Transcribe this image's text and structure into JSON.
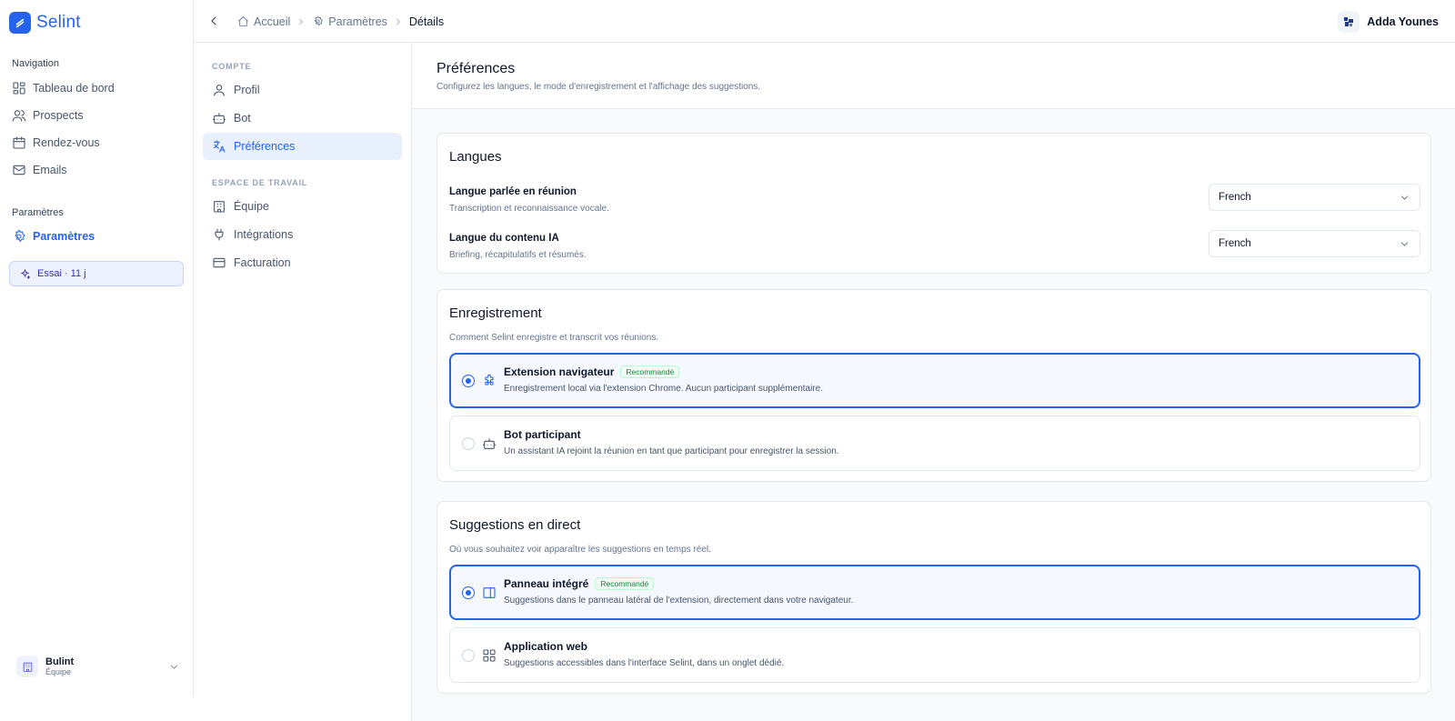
{
  "app": {
    "name": "Selint"
  },
  "sidebar": {
    "nav_section": "Navigation",
    "items": [
      {
        "label": "Tableau de bord",
        "icon": "dashboard-icon"
      },
      {
        "label": "Prospects",
        "icon": "users-icon"
      },
      {
        "label": "Rendez-vous",
        "icon": "calendar-icon"
      },
      {
        "label": "Emails",
        "icon": "mail-icon"
      }
    ],
    "settings_section": "Paramètres",
    "settings_item": {
      "label": "Paramètres",
      "icon": "gear-icon"
    },
    "trial": "Essai · 11 j",
    "team": {
      "name": "Bulint",
      "role": "Équipe"
    }
  },
  "header": {
    "breadcrumbs": [
      "Accueil",
      "Paramètres",
      "Détails"
    ],
    "user": "Adda Younes"
  },
  "settings_nav": {
    "account_section": "COMPTE",
    "account_items": [
      {
        "label": "Profil",
        "icon": "user-icon"
      },
      {
        "label": "Bot",
        "icon": "bot-icon"
      },
      {
        "label": "Préférences",
        "icon": "translate-icon",
        "active": true
      }
    ],
    "workspace_section": "ESPACE DE TRAVAIL",
    "workspace_items": [
      {
        "label": "Équipe",
        "icon": "building-icon"
      },
      {
        "label": "Intégrations",
        "icon": "plug-icon"
      },
      {
        "label": "Facturation",
        "icon": "credit-card-icon"
      }
    ]
  },
  "page": {
    "title": "Préférences",
    "subtitle": "Configurez les langues, le mode d'enregistrement et l'affichage des suggestions."
  },
  "languages": {
    "title": "Langues",
    "rows": [
      {
        "label": "Langue parlée en réunion",
        "help": "Transcription et reconnaissance vocale.",
        "value": "French"
      },
      {
        "label": "Langue du contenu IA",
        "help": "Briefing, récapitulatifs et résumés.",
        "value": "French"
      }
    ]
  },
  "recording": {
    "title": "Enregistrement",
    "description": "Comment Selint enregistre et transcrit vos réunions.",
    "options": [
      {
        "title": "Extension navigateur",
        "badge": "Recommandé",
        "desc": "Enregistrement local via l'extension Chrome. Aucun participant supplémentaire.",
        "selected": true,
        "icon": "puzzle-icon"
      },
      {
        "title": "Bot participant",
        "desc": "Un assistant IA rejoint la réunion en tant que participant pour enregistrer la session.",
        "selected": false,
        "icon": "bot-icon"
      }
    ]
  },
  "suggestions": {
    "title": "Suggestions en direct",
    "description": "Où vous souhaitez voir apparaître les suggestions en temps réel.",
    "options": [
      {
        "title": "Panneau intégré",
        "badge": "Recommandé",
        "desc": "Suggestions dans le panneau latéral de l'extension, directement dans votre navigateur.",
        "selected": true,
        "icon": "side-panel-icon"
      },
      {
        "title": "Application web",
        "desc": "Suggestions accessibles dans l'interface Selint, dans un onglet dédié.",
        "selected": false,
        "icon": "grid-icon"
      }
    ]
  },
  "colors": {
    "accent": "#2563eb",
    "badge": "#15803d"
  }
}
